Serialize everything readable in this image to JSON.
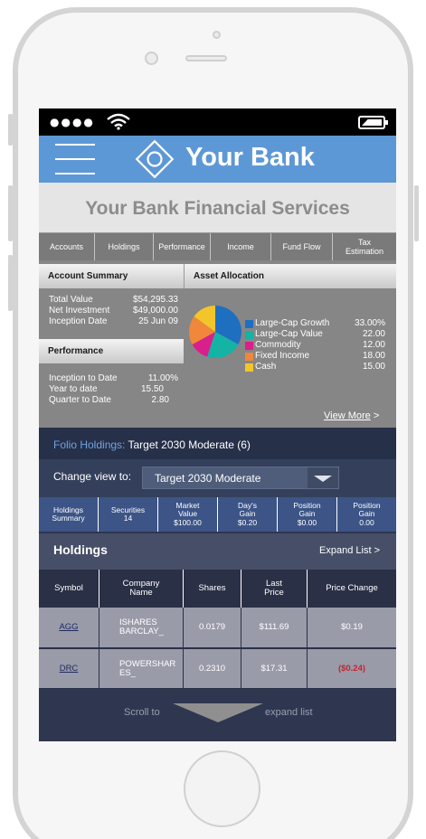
{
  "header": {
    "brand": "Your Bank"
  },
  "title": "Your Bank Financial Services",
  "tabs": [
    {
      "label": "Accounts"
    },
    {
      "label": "Holdings"
    },
    {
      "label": "Performance"
    },
    {
      "label": "Income"
    },
    {
      "label": "Fund Flow"
    },
    {
      "label": "Tax Estimation"
    }
  ],
  "account_summary": {
    "title": "Account Summary",
    "rows": [
      {
        "label": "Total Value",
        "value": "$54,295.33"
      },
      {
        "label": "Net Investment",
        "value": "$49,000.00"
      },
      {
        "label": "Inception Date",
        "value": "25 Jun 09"
      }
    ]
  },
  "performance": {
    "title": "Performance",
    "rows": [
      {
        "label": "Inception to Date",
        "value": "11.00%"
      },
      {
        "label": "Year to date",
        "value": "15.50"
      },
      {
        "label": "Quarter to Date",
        "value": "2.80"
      }
    ]
  },
  "asset_allocation": {
    "title": "Asset Allocation",
    "view_more": "View More",
    "view_more_arrow": ">"
  },
  "chart_data": {
    "type": "pie",
    "categories": [
      "Large-Cap Growth",
      "Large-Cap Value",
      "Commodity",
      "Fixed Income",
      "Cash"
    ],
    "labels": [
      "33.00%",
      "22.00",
      "12.00",
      "18.00",
      "15.00"
    ],
    "values": [
      33,
      22,
      12,
      18,
      15
    ],
    "colors": [
      "#1f6fc1",
      "#14b3a4",
      "#d91f8c",
      "#f0873a",
      "#f4c52a"
    ]
  },
  "folio": {
    "label": "Folio Holdings:",
    "value": "Target 2030 Moderate (6)"
  },
  "change_view": {
    "label": "Change view to:",
    "selected": "Target 2030 Moderate"
  },
  "stats": [
    {
      "label": "Holdings Summary",
      "value": ""
    },
    {
      "label": "Securities",
      "value": "14"
    },
    {
      "label": "Market Value",
      "value": "$100.00"
    },
    {
      "label": "Day's Gain",
      "value": "$0.20"
    },
    {
      "label": "Position Gain",
      "value": "$0.00"
    },
    {
      "label": "Position Gain",
      "value": "0.00"
    }
  ],
  "holdings": {
    "title": "Holdings",
    "expand": "Expand List >",
    "columns": [
      "Symbol",
      "Company Name",
      "Shares",
      "Last Price",
      "Price Change"
    ],
    "rows": [
      {
        "symbol": "AGG",
        "company": "ISHARES BARCLAY_",
        "shares": "0.0179",
        "last": "$111.69",
        "change": "$0.19"
      },
      {
        "symbol": "DRC",
        "company": "POWERSHAR ES_",
        "shares": "0.2310",
        "last": "$17.31",
        "change": "($0.24)"
      }
    ]
  },
  "scroll": {
    "left": "Scroll to",
    "right": "expand list"
  },
  "colors": {
    "header": "#5d98d6",
    "accent_blue": "#3c5486",
    "negative": "#c0272d"
  }
}
